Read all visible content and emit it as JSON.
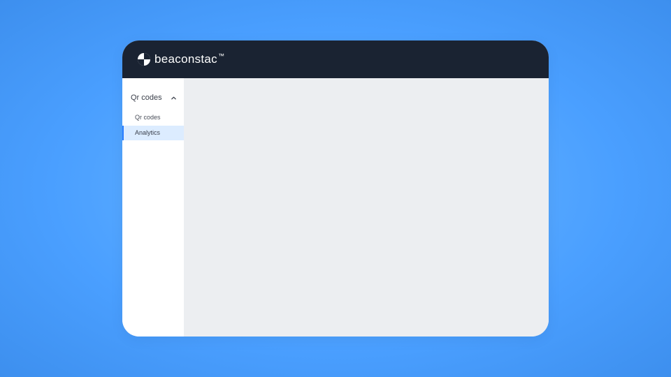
{
  "header": {
    "brand_name": "beaconstac",
    "brand_suffix": "™"
  },
  "sidebar": {
    "section": {
      "label": "Qr codes",
      "expanded": true,
      "items": [
        {
          "label": "Qr codes",
          "active": false
        },
        {
          "label": "Analytics",
          "active": true
        }
      ]
    }
  }
}
